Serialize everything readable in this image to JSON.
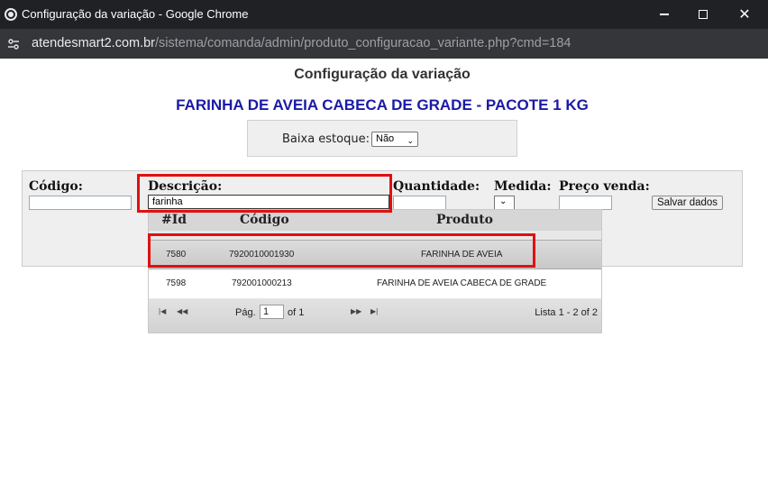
{
  "window": {
    "title": "Configuração da variação - Google Chrome",
    "url_host": "atendesmart2.com.br",
    "url_path": "/sistema/comanda/admin/produto_configuracao_variante.php?cmd=184"
  },
  "page": {
    "title": "Configuração da variação",
    "product_name": "FARINHA DE AVEIA CABECA DE GRADE - PACOTE 1 KG",
    "baixa_estoque_label": "Baixa estoque:",
    "baixa_estoque_value": "Não"
  },
  "form": {
    "codigo_label": "Código:",
    "descricao_label": "Descrição:",
    "descricao_value": "farinha",
    "quantidade_label": "Quantidade:",
    "medida_label": "Medida:",
    "preco_label": "Preço venda:",
    "save_label": "Salvar dados"
  },
  "grid": {
    "headers": [
      "#Id",
      "Código",
      "Produto"
    ],
    "rows": [
      {
        "id": "7580",
        "codigo": "7920010001930",
        "produto": "FARINHA DE AVEIA"
      },
      {
        "id": "7598",
        "codigo": "792001000213",
        "produto": "FARINHA DE AVEIA CABECA DE GRADE"
      }
    ],
    "pager": {
      "page_label": "Pág.",
      "page_value": "1",
      "of_label": "of 1",
      "info": "Lista 1 - 2 of 2"
    }
  },
  "icons": {
    "app": "chrome-icon",
    "minimize": "minimize-icon",
    "maximize": "maximize-icon",
    "close": "close-icon",
    "site_info": "tune-icon"
  },
  "colors": {
    "titlebar": "#202124",
    "addressbar": "#35363a",
    "product_title": "#1a1aa6",
    "highlight": "#e01010"
  }
}
